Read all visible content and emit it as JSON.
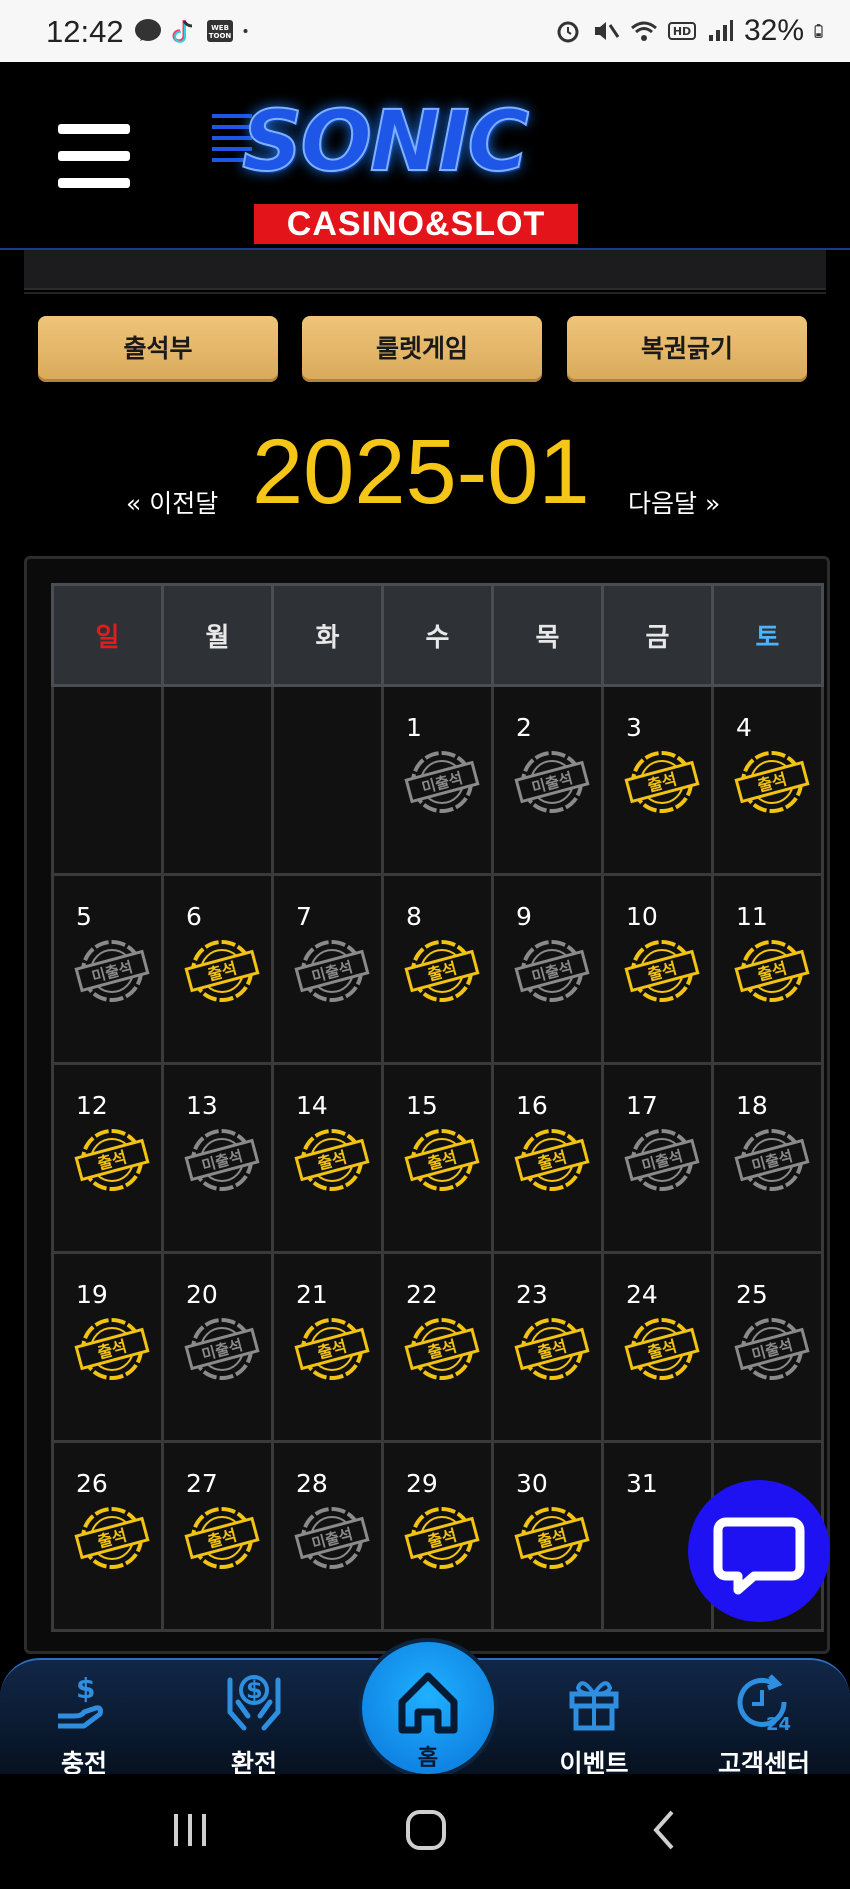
{
  "status_bar": {
    "time": "12:42",
    "battery": "32%",
    "icons": [
      "messenger-icon",
      "tiktok-icon",
      "webtoon-icon",
      "dot-icon",
      "alarm-icon",
      "mute-icon",
      "wifi-icon",
      "hd-icon",
      "signal-icon",
      "battery-icon"
    ]
  },
  "header": {
    "logo_text": "SONIC",
    "logo_subtext": "CASINO&SLOT",
    "menu_icon": "hamburger-icon"
  },
  "actions": {
    "attendance": "출석부",
    "roulette": "룰렛게임",
    "lottery": "복권긁기"
  },
  "month_nav": {
    "prev": "« 이전달",
    "current": "2025-01",
    "next": "다음달 »"
  },
  "calendar": {
    "weekdays": [
      "일",
      "월",
      "화",
      "수",
      "목",
      "금",
      "토"
    ],
    "weeks": [
      [
        {
          "d": "",
          "s": ""
        },
        {
          "d": "",
          "s": ""
        },
        {
          "d": "",
          "s": ""
        },
        {
          "d": "1",
          "s": "미출석"
        },
        {
          "d": "2",
          "s": "미출석"
        },
        {
          "d": "3",
          "s": "출석"
        },
        {
          "d": "4",
          "s": "출석"
        }
      ],
      [
        {
          "d": "5",
          "s": "미출석"
        },
        {
          "d": "6",
          "s": "출석"
        },
        {
          "d": "7",
          "s": "미출석"
        },
        {
          "d": "8",
          "s": "출석"
        },
        {
          "d": "9",
          "s": "미출석"
        },
        {
          "d": "10",
          "s": "출석"
        },
        {
          "d": "11",
          "s": "출석"
        }
      ],
      [
        {
          "d": "12",
          "s": "출석"
        },
        {
          "d": "13",
          "s": "미출석"
        },
        {
          "d": "14",
          "s": "출석"
        },
        {
          "d": "15",
          "s": "출석"
        },
        {
          "d": "16",
          "s": "출석"
        },
        {
          "d": "17",
          "s": "미출석"
        },
        {
          "d": "18",
          "s": "미출석"
        }
      ],
      [
        {
          "d": "19",
          "s": "출석"
        },
        {
          "d": "20",
          "s": "미출석"
        },
        {
          "d": "21",
          "s": "출석"
        },
        {
          "d": "22",
          "s": "출석"
        },
        {
          "d": "23",
          "s": "출석"
        },
        {
          "d": "24",
          "s": "출석"
        },
        {
          "d": "25",
          "s": "미출석"
        }
      ],
      [
        {
          "d": "26",
          "s": "출석"
        },
        {
          "d": "27",
          "s": "출석"
        },
        {
          "d": "28",
          "s": "미출석"
        },
        {
          "d": "29",
          "s": "출석"
        },
        {
          "d": "30",
          "s": "출석"
        },
        {
          "d": "31",
          "s": ""
        },
        {
          "d": "",
          "s": ""
        }
      ]
    ]
  },
  "bottom_nav": {
    "deposit": "충전",
    "withdraw": "환전",
    "home": "홈",
    "event": "이벤트",
    "support": "고객센터"
  },
  "colors": {
    "gold": "#f5c518",
    "button_gold": "#e0b066",
    "sunday": "#e51b1b",
    "saturday": "#4cb4ff",
    "chat_fab": "#1f12f2",
    "nav_icon": "#2e8fe0"
  }
}
